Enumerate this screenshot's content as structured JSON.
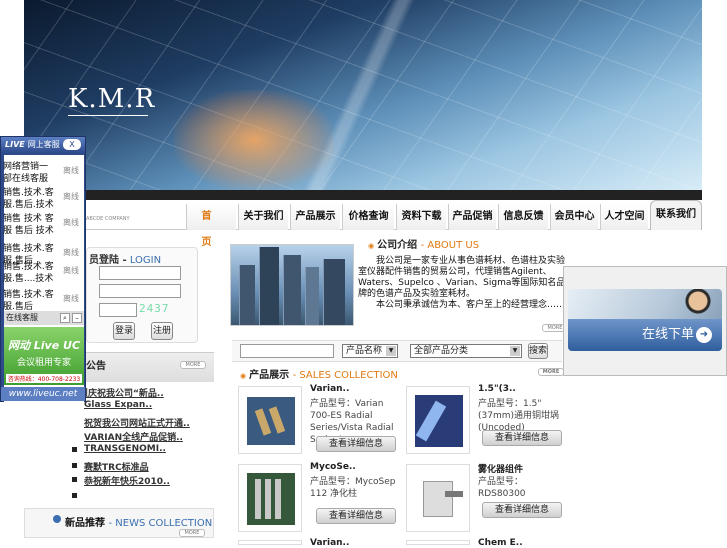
{
  "brand": {
    "logo": "K.M.R",
    "nav_subtitle": "ABCDE COMPANY"
  },
  "nav": {
    "items": [
      "首　页",
      "关于我们",
      "产品展示",
      "价格查询",
      "资料下载",
      "产品促销",
      "信息反馈",
      "会员中心",
      "人才空间",
      "联系我们"
    ]
  },
  "chat": {
    "title_live": "LIVE",
    "title": "网上客服",
    "close": "X",
    "staff": [
      {
        "name": "网络营销一部在线客服",
        "status": "离线"
      },
      {
        "name": "销售.技术.客服.售后.技术",
        "status": "离线"
      },
      {
        "name": "销售 技术 客服 售后 技术",
        "status": "离线"
      },
      {
        "name": "销售.技术.客服.售后",
        "status": "离线"
      },
      {
        "name": "销售.技术.客服.售....技术",
        "status": "离线"
      },
      {
        "name": "销售.技术.客服.售后",
        "status": "离线"
      }
    ],
    "tool_label": "在线客服",
    "ad_line1": "网动 Live UC",
    "ad_line2": "会议租用专家",
    "ad_phone": "咨询热线：400-708-2233",
    "footer": "www.liveuc.net"
  },
  "login": {
    "title_cn": "员登陆 -",
    "title_en": "LOGIN",
    "code": "2437",
    "btn1": "登录",
    "btn2": "注册"
  },
  "notice": {
    "title": "公告",
    "more": "MORE"
  },
  "news": [
    "热烈庆祝我公司“新品..",
    "Glass Expan..",
    "祝贺我公司网站正式开通..",
    "VARIAN全线产品促销..",
    "TRANSGENOMI..",
    "赛默TRC标准品",
    "恭祝新年快乐2010.."
  ],
  "new_products": {
    "title_cn": "新品推荐",
    "title_en": "- NEWS COLLECTION",
    "more": "MORE"
  },
  "about": {
    "title_cn": "公司介绍",
    "title_en": "- ABOUT US",
    "more": "MORE",
    "text": "　　我公司是一家专业从事色谱耗材、色谱柱及实验室仪器配件销售的贸易公司，代理销售Agilent、Waters、Supelco 、Varian、Sigma等国际知名品牌的色谱产品及实验室耗材。",
    "text2": "　　本公司秉承诚信为本、客户至上的经营理念……"
  },
  "search": {
    "select1": "产品名称",
    "select2": "全部产品分类",
    "button": "搜索"
  },
  "sales": {
    "title_cn": "产品展示",
    "title_en": "- SALES COLLECTION",
    "more": "MORE",
    "products": [
      {
        "name": "Varian..",
        "desc": "产品型号：Varian 700-ES Radial Series/Vista Radial Series/",
        "button": "查看详细信息"
      },
      {
        "name": "1.5\"(3..",
        "desc": "产品型号：1.5\"(37mm)通用铜坩埚(Uncoded)",
        "button": "查看详细信息"
      },
      {
        "name": "MycoSe..",
        "desc": "产品型号：MycoSep 112 净化柱",
        "button": "查看详细信息"
      },
      {
        "name": "雾化器组件",
        "desc": "产品型号：RDS80300",
        "button": "查看详细信息"
      },
      {
        "name": "Varian..",
        "desc": "",
        "button": ""
      },
      {
        "name": "Chem E..",
        "desc": "",
        "button": ""
      }
    ]
  },
  "order": {
    "label": "在线下单",
    "go": "➜"
  }
}
